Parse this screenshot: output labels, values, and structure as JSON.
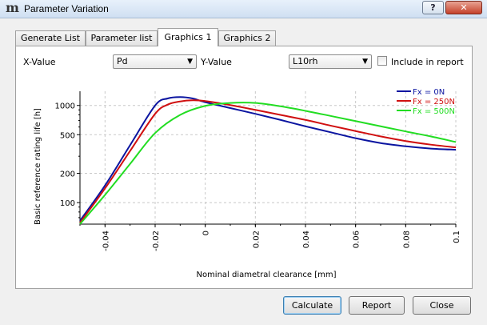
{
  "window": {
    "title": "Parameter Variation",
    "help_label": "?",
    "close_label": "✕",
    "app_icon": "mesys-logo-icon"
  },
  "tabs": [
    {
      "label": "Generate List",
      "active": false
    },
    {
      "label": "Parameter list",
      "active": false
    },
    {
      "label": "Graphics 1",
      "active": true
    },
    {
      "label": "Graphics 2",
      "active": false
    }
  ],
  "controls": {
    "x_label": "X-Value",
    "x_value": "Pd",
    "y_label": "Y-Value",
    "y_value": "L10rh",
    "include_label": "Include in report",
    "include_checked": false
  },
  "chart_data": {
    "type": "line",
    "xlabel": "Nominal diametral clearance [mm]",
    "ylabel": "Basic reference rating life [h]",
    "xlim": [
      -0.05,
      0.1
    ],
    "ylim": [
      60,
      1400
    ],
    "y_scale": "log",
    "x_ticks": [
      "-0.04",
      "-0.02",
      "0",
      "0.02",
      "0.04",
      "0.06",
      "0.08",
      "0.1"
    ],
    "y_ticks": [
      "100",
      "200",
      "500",
      "1000"
    ],
    "grid": true,
    "legend_position": "top-right",
    "series": [
      {
        "name": "Fx = 0N",
        "color": "#0a14a0",
        "x": [
          -0.05,
          -0.04,
          -0.03,
          -0.02,
          -0.015,
          -0.01,
          -0.005,
          0,
          0.01,
          0.02,
          0.03,
          0.04,
          0.05,
          0.06,
          0.07,
          0.08,
          0.09,
          0.1
        ],
        "y": [
          65,
          150,
          390,
          1000,
          1180,
          1220,
          1180,
          1080,
          940,
          820,
          710,
          610,
          530,
          460,
          410,
          380,
          360,
          350
        ]
      },
      {
        "name": "Fx = 250N",
        "color": "#d01010",
        "x": [
          -0.05,
          -0.04,
          -0.03,
          -0.02,
          -0.015,
          -0.01,
          -0.005,
          0,
          0.01,
          0.02,
          0.03,
          0.04,
          0.05,
          0.06,
          0.07,
          0.08,
          0.09,
          0.1
        ],
        "y": [
          62,
          140,
          340,
          820,
          1020,
          1100,
          1130,
          1110,
          1010,
          900,
          800,
          710,
          620,
          545,
          480,
          430,
          395,
          370
        ]
      },
      {
        "name": "Fx = 500N",
        "color": "#22dd22",
        "x": [
          -0.05,
          -0.04,
          -0.03,
          -0.02,
          -0.01,
          0,
          0.01,
          0.02,
          0.03,
          0.04,
          0.05,
          0.06,
          0.07,
          0.08,
          0.09,
          0.1
        ],
        "y": [
          60,
          120,
          250,
          520,
          800,
          990,
          1060,
          1060,
          980,
          880,
          780,
          690,
          610,
          540,
          480,
          420
        ]
      }
    ]
  },
  "buttons": {
    "calculate": "Calculate",
    "report": "Report",
    "close": "Close"
  }
}
